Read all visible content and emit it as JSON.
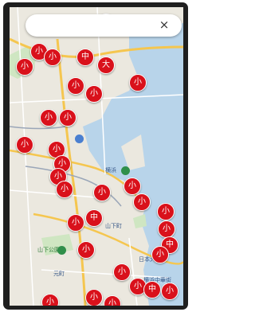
{
  "search": {
    "placeholder": "",
    "value": ""
  },
  "close_glyph": "×",
  "map": {
    "labels": [
      {
        "text": "横浜",
        "kind": "station"
      },
      {
        "text": "日本大",
        "kind": "place"
      },
      {
        "text": "山下公園",
        "kind": "park"
      },
      {
        "text": "横浜中華街",
        "kind": "place"
      },
      {
        "text": "山下町",
        "kind": "place"
      },
      {
        "text": "元町",
        "kind": "place"
      }
    ],
    "pins": [
      {
        "glyph": "小",
        "type": "small"
      },
      {
        "glyph": "中",
        "type": "medium"
      },
      {
        "glyph": "大",
        "type": "large"
      }
    ],
    "colors": {
      "water": "#b8d4ea",
      "park": "#cfe6c2",
      "land": "#ebe8df",
      "pin": "#d9111b",
      "road": "#f5c64f"
    }
  }
}
